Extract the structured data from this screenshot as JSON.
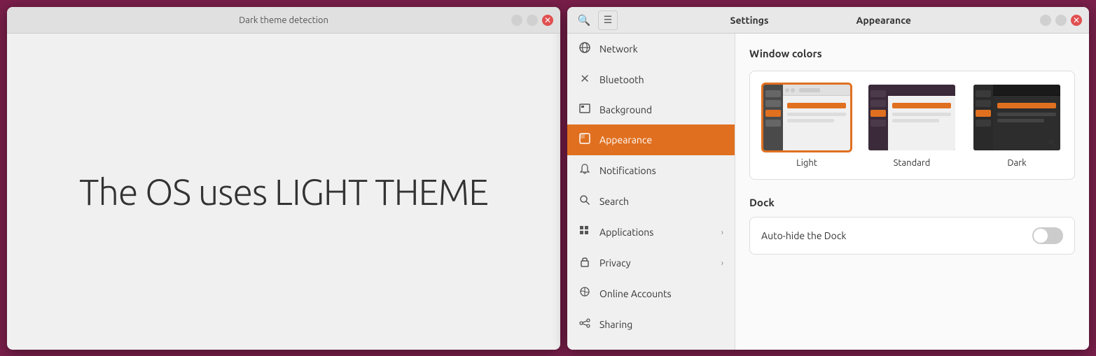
{
  "leftWindow": {
    "title": "Dark theme detection",
    "themeText": "The OS uses LIGHT THEME"
  },
  "rightWindow": {
    "settingsTitle": "Settings",
    "appearanceTitle": "Appearance",
    "sidebar": {
      "items": [
        {
          "id": "network",
          "label": "Network",
          "icon": "🌐",
          "hasChevron": false
        },
        {
          "id": "bluetooth",
          "label": "Bluetooth",
          "icon": "⬡",
          "hasChevron": false
        },
        {
          "id": "background",
          "label": "Background",
          "icon": "🖼",
          "hasChevron": false
        },
        {
          "id": "appearance",
          "label": "Appearance",
          "icon": "🎨",
          "hasChevron": false,
          "active": true
        },
        {
          "id": "notifications",
          "label": "Notifications",
          "icon": "🔔",
          "hasChevron": false
        },
        {
          "id": "search",
          "label": "Search",
          "icon": "🔍",
          "hasChevron": false
        },
        {
          "id": "applications",
          "label": "Applications",
          "icon": "⊞",
          "hasChevron": true
        },
        {
          "id": "privacy",
          "label": "Privacy",
          "icon": "🔒",
          "hasChevron": true
        },
        {
          "id": "online-accounts",
          "label": "Online Accounts",
          "icon": "☁",
          "hasChevron": false
        },
        {
          "id": "sharing",
          "label": "Sharing",
          "icon": "⇄",
          "hasChevron": false
        }
      ]
    },
    "content": {
      "windowColorsTitle": "Window colors",
      "themes": [
        {
          "id": "light",
          "label": "Light",
          "selected": true
        },
        {
          "id": "standard",
          "label": "Standard",
          "selected": false
        },
        {
          "id": "dark",
          "label": "Dark",
          "selected": false
        }
      ],
      "dockTitle": "Dock",
      "dockOptions": [
        {
          "id": "auto-hide",
          "label": "Auto-hide the Dock",
          "toggled": false
        }
      ]
    }
  }
}
